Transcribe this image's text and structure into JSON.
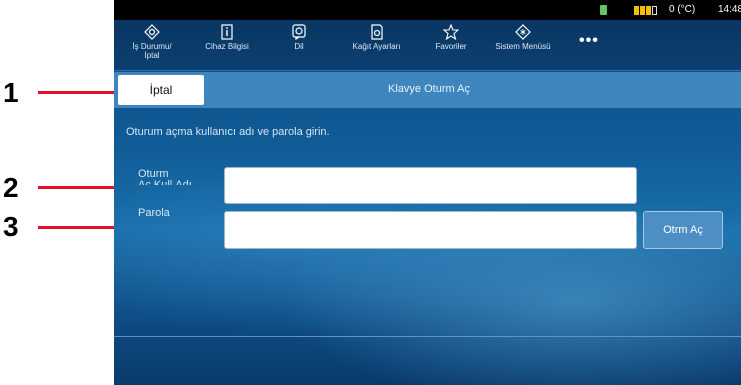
{
  "callouts": [
    "1",
    "2",
    "3"
  ],
  "status_bar": {
    "temperature": "0 (°C)",
    "time": "14:48"
  },
  "toolbar": {
    "items": [
      {
        "label_line1": "İş Durumu/",
        "label_line2": "İptal",
        "icon": "job-status-icon"
      },
      {
        "label_line1": "Cihaz Bilgisi",
        "label_line2": "",
        "icon": "device-info-icon"
      },
      {
        "label_line1": "Dil",
        "label_line2": "",
        "icon": "language-icon"
      },
      {
        "label_line1": "Kağıt Ayarları",
        "label_line2": "",
        "icon": "paper-settings-icon"
      },
      {
        "label_line1": "Favoriler",
        "label_line2": "",
        "icon": "star-icon"
      },
      {
        "label_line1": "Sistem Menüsü",
        "label_line2": "",
        "icon": "system-menu-icon"
      }
    ],
    "more": "•••"
  },
  "tabbar": {
    "cancel_label": "İptal",
    "title": "Klavye Oturm Aç"
  },
  "form": {
    "instruction": "Oturum açma kullanıcı adı ve parola girin.",
    "username_label_line1": "Oturm",
    "username_label_line2": "Aç Kull.Adı",
    "username_value": "",
    "password_label": "Parola",
    "password_value": "",
    "login_button": "Otrm Aç"
  },
  "colors": {
    "callout_line": "#e8102a",
    "accent": "#3e86bd"
  }
}
